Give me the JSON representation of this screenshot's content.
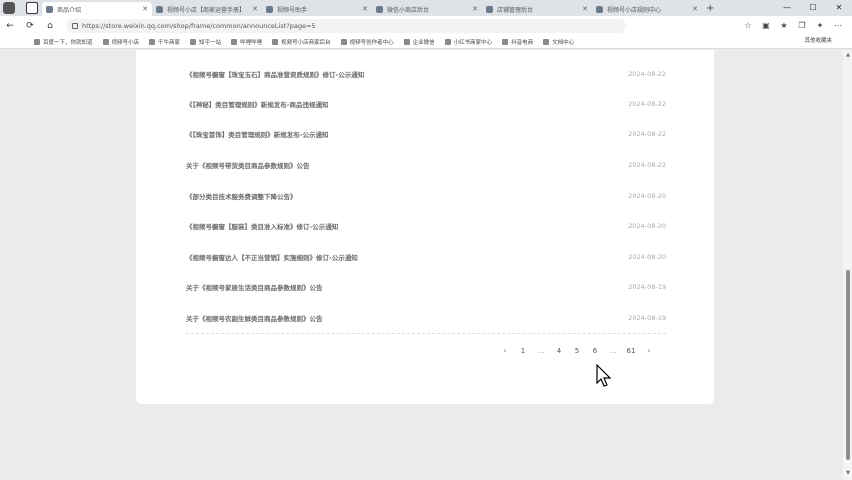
{
  "browser": {
    "tabs": [
      {
        "title": "商品介绍",
        "active": true
      },
      {
        "title": "视频号小店【商家运营手册】",
        "active": false
      },
      {
        "title": "视频号助手",
        "active": false
      },
      {
        "title": "微信小商店后台",
        "active": false
      },
      {
        "title": "店铺管理后台",
        "active": false
      },
      {
        "title": "视频号小店规则中心",
        "active": false
      }
    ],
    "new_tab_label": "+",
    "window_controls": {
      "minimize": "—",
      "maximize": "☐",
      "close": "✕"
    },
    "nav": {
      "back": "←",
      "reload": "⟳",
      "home": "⌂"
    },
    "url": "https://store.weixin.qq.com/shop/frame/common/announceList?page=5",
    "bookmarks": [
      "百度一下，你就知道",
      "视频号小店",
      "千牛商家",
      "知乎一站",
      "哔哩哔哩",
      "视频号小店商家后台",
      "视频号创作者中心",
      "企业微信",
      "小红书商家中心",
      "抖音电商",
      "文档中心"
    ],
    "other_bookmarks": "其他收藏夹"
  },
  "announcements": [
    {
      "title": "《视频号橱窗【珠宝玉石】商品准营资质规则》修订-公示通知",
      "date": "2024-08-22"
    },
    {
      "title": "《【神秘】类目管理规则》新规发布-商品违规通知",
      "date": "2024-08-22"
    },
    {
      "title": "《【珠宝首饰】类目管理规则》新规发布-公示通知",
      "date": "2024-08-22"
    },
    {
      "title": "关于《视频号带货类目商品参数规则》公告",
      "date": "2024-08-22"
    },
    {
      "title": "《部分类目技术服务费调整下降公告》",
      "date": "2024-08-20"
    },
    {
      "title": "《视频号橱窗【服装】类目准入标准》修订-公示通知",
      "date": "2024-08-20"
    },
    {
      "title": "《视频号橱窗达人【不正当营销】实施细则》修订-公示通知",
      "date": "2024-08-20"
    },
    {
      "title": "关于《视频号家居生活类目商品参数规则》公告",
      "date": "2024-08-19"
    },
    {
      "title": "关于《视频号农副生鲜类目商品参数规则》公告",
      "date": "2024-08-19"
    }
  ],
  "pagination": {
    "prev": "‹",
    "first": "1",
    "ellipsis_left": "...",
    "pages": [
      "4",
      "5",
      "6"
    ],
    "current": "5",
    "ellipsis_right": "...",
    "last": "61",
    "next": "›"
  }
}
